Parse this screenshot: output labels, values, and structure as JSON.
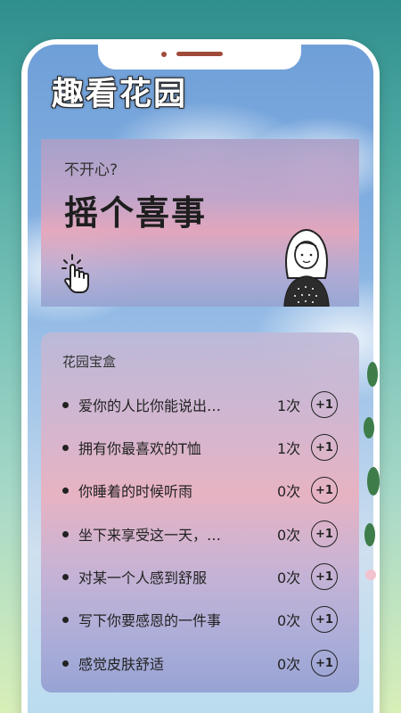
{
  "app": {
    "title": "趣看花园"
  },
  "banner": {
    "subtitle": "不开心?",
    "headline": "摇个喜事"
  },
  "treasure_box": {
    "title": "花园宝盒",
    "plus_label": "+1",
    "items": [
      {
        "label": "爱你的人比你能说出…",
        "count": "1次"
      },
      {
        "label": "拥有你最喜欢的T恤",
        "count": "1次"
      },
      {
        "label": "你睡着的时候听雨",
        "count": "0次"
      },
      {
        "label": "坐下来享受这一天，…",
        "count": "0次"
      },
      {
        "label": "对某一个人感到舒服",
        "count": "0次"
      },
      {
        "label": "写下你要感恩的一件事",
        "count": "0次"
      },
      {
        "label": "感觉皮肤舒适",
        "count": "0次"
      }
    ]
  },
  "colors": {
    "accent": "#a04a3a",
    "text": "#222222"
  },
  "icons": {
    "tap": "hand-tap-icon",
    "avatar": "girl-avatar-icon"
  }
}
